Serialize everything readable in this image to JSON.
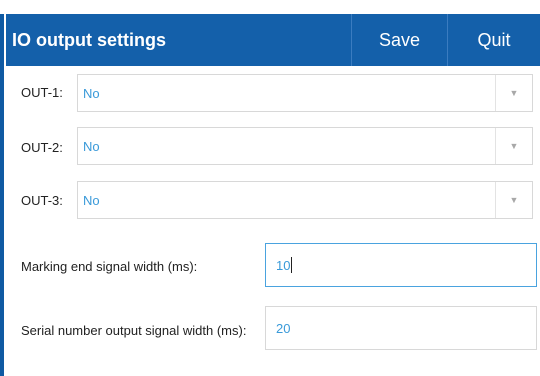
{
  "header": {
    "title": "IO output settings",
    "save_label": "Save",
    "quit_label": "Quit"
  },
  "outputs": [
    {
      "label": "OUT-1:",
      "value": "No"
    },
    {
      "label": "OUT-2:",
      "value": "No"
    },
    {
      "label": "OUT-3:",
      "value": "No"
    }
  ],
  "marking_end": {
    "label": "Marking end signal width (ms):",
    "value": "10"
  },
  "serial_number": {
    "label": "Serial number output signal width (ms):",
    "value": "20"
  },
  "colors": {
    "header_bg": "#1460aa",
    "value_text": "#3a9ad9"
  },
  "icons": {
    "dropdown": "chevron-down-icon"
  }
}
